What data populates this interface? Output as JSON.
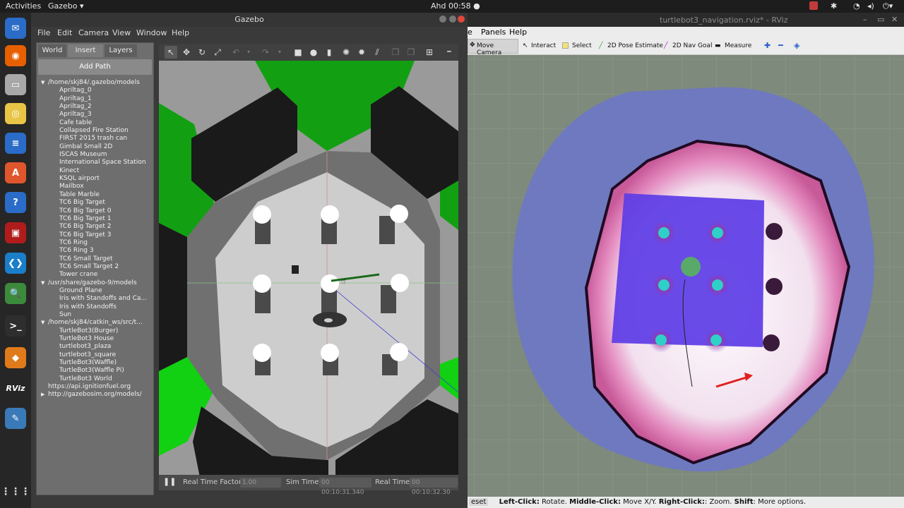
{
  "topbar": {
    "activities": "Activities",
    "app_menu": "Gazebo ▾",
    "clock": "Ahd 00:58 ●"
  },
  "dock": {
    "items": [
      {
        "name": "Thunderbird",
        "color": "#2a6cc7",
        "glyph": "✉"
      },
      {
        "name": "Firefox",
        "color": "#e66000",
        "glyph": "◉"
      },
      {
        "name": "Files",
        "color": "#a8a8a8",
        "glyph": "▭"
      },
      {
        "name": "Rhythmbox",
        "color": "#e8c547",
        "glyph": "◎"
      },
      {
        "name": "Writer",
        "color": "#2a6cc7",
        "glyph": "≡"
      },
      {
        "name": "Software",
        "color": "#e0562c",
        "glyph": "A"
      },
      {
        "name": "Help",
        "color": "#2a6cc7",
        "glyph": "?"
      },
      {
        "name": "Terminator",
        "color": "#b01c1c",
        "glyph": "▣"
      },
      {
        "name": "VS Code",
        "color": "#1a7ec9",
        "glyph": "❮❯"
      },
      {
        "name": "Image Viewer",
        "color": "#3c8a3c",
        "glyph": "🔍"
      },
      {
        "name": "Terminal",
        "color": "#2e2e2e",
        "glyph": ">_"
      },
      {
        "name": "Gazebo",
        "color": "#e07b1c",
        "glyph": "◆"
      },
      {
        "name": "RViz",
        "color": "#262626",
        "glyph": "RViz"
      },
      {
        "name": "Screenshot",
        "color": "#3a7ab8",
        "glyph": "✎"
      }
    ],
    "grid": "⋮⋮⋮"
  },
  "gazebo": {
    "title": "Gazebo",
    "menu": [
      "File",
      "Edit",
      "Camera",
      "View",
      "Window",
      "Help"
    ],
    "tabs": [
      "World",
      "Insert",
      "Layers"
    ],
    "add_path": "Add Path",
    "tree": [
      {
        "level": 0,
        "expanded": true,
        "label": "/home/skj84/.gazebo/models"
      },
      {
        "level": 1,
        "label": "Apriltag_0"
      },
      {
        "level": 1,
        "label": "Apriltag_1"
      },
      {
        "level": 1,
        "label": "Apriltag_2"
      },
      {
        "level": 1,
        "label": "Apriltag_3"
      },
      {
        "level": 1,
        "label": "Cafe table"
      },
      {
        "level": 1,
        "label": "Collapsed Fire Station"
      },
      {
        "level": 1,
        "label": "FIRST 2015 trash can"
      },
      {
        "level": 1,
        "label": "Gimbal Small 2D"
      },
      {
        "level": 1,
        "label": "ISCAS Museum"
      },
      {
        "level": 1,
        "label": "International Space Station"
      },
      {
        "level": 1,
        "label": "Kinect"
      },
      {
        "level": 1,
        "label": "KSQL airport"
      },
      {
        "level": 1,
        "label": "Mailbox"
      },
      {
        "level": 1,
        "label": "Table Marble"
      },
      {
        "level": 1,
        "label": "TC6 Big Target"
      },
      {
        "level": 1,
        "label": "TC6 Big Target 0"
      },
      {
        "level": 1,
        "label": "TC6 Big Target 1"
      },
      {
        "level": 1,
        "label": "TC6 Big Target 2"
      },
      {
        "level": 1,
        "label": "TC6 Big Target 3"
      },
      {
        "level": 1,
        "label": "TC6 Ring"
      },
      {
        "level": 1,
        "label": "TC6 Ring 3"
      },
      {
        "level": 1,
        "label": "TC6 Small Target"
      },
      {
        "level": 1,
        "label": "TC6 Small Target 2"
      },
      {
        "level": 1,
        "label": "Tower crane"
      },
      {
        "level": 0,
        "expanded": true,
        "label": "/usr/share/gazebo-9/models"
      },
      {
        "level": 1,
        "label": "Ground Plane"
      },
      {
        "level": 1,
        "label": "Iris with Standoffs and Ca..."
      },
      {
        "level": 1,
        "label": "Iris with Standoffs"
      },
      {
        "level": 1,
        "label": "Sun"
      },
      {
        "level": 0,
        "expanded": true,
        "label": "/home/skj84/catkin_ws/src/t..."
      },
      {
        "level": 1,
        "label": "TurtleBot3(Burger)"
      },
      {
        "level": 1,
        "label": "TurtleBot3 House"
      },
      {
        "level": 1,
        "label": "turtlebot3_plaza"
      },
      {
        "level": 1,
        "label": "turtlebot3_square"
      },
      {
        "level": 1,
        "label": "TurtleBot3(Waffle)"
      },
      {
        "level": 1,
        "label": "TurtleBot3(Waffle Pi)"
      },
      {
        "level": 1,
        "label": "TurtleBot3 World"
      },
      {
        "level": 0,
        "leaf": true,
        "label": "https://api.ignitionfuel.org"
      },
      {
        "level": 0,
        "expanded": false,
        "label": "http://gazebosim.org/models/"
      }
    ],
    "bottom": {
      "rtf_label": "Real Time Factor:",
      "rtf_value": "1.00",
      "sim_label": "Sim Time:",
      "sim_value": "00 00:10:31.340",
      "real_label": "Real Time:",
      "real_value": "00 00:10:32.30"
    }
  },
  "rviz": {
    "title": "turtlebot3_navigation.rviz* - RViz",
    "menu": [
      "Panels",
      "Help"
    ],
    "tools": [
      "Move Camera",
      "Interact",
      "Select",
      "2D Pose Estimate",
      "2D Nav Goal",
      "Measure"
    ],
    "status_reset": "eset",
    "status_parts": [
      {
        "b": "Left-Click:",
        "t": " Rotate. "
      },
      {
        "b": "Middle-Click:",
        "t": " Move X/Y. "
      },
      {
        "b": "Right-Click:",
        "t": ": Zoom. "
      },
      {
        "b": "Shift",
        "t": ": More options."
      }
    ]
  }
}
